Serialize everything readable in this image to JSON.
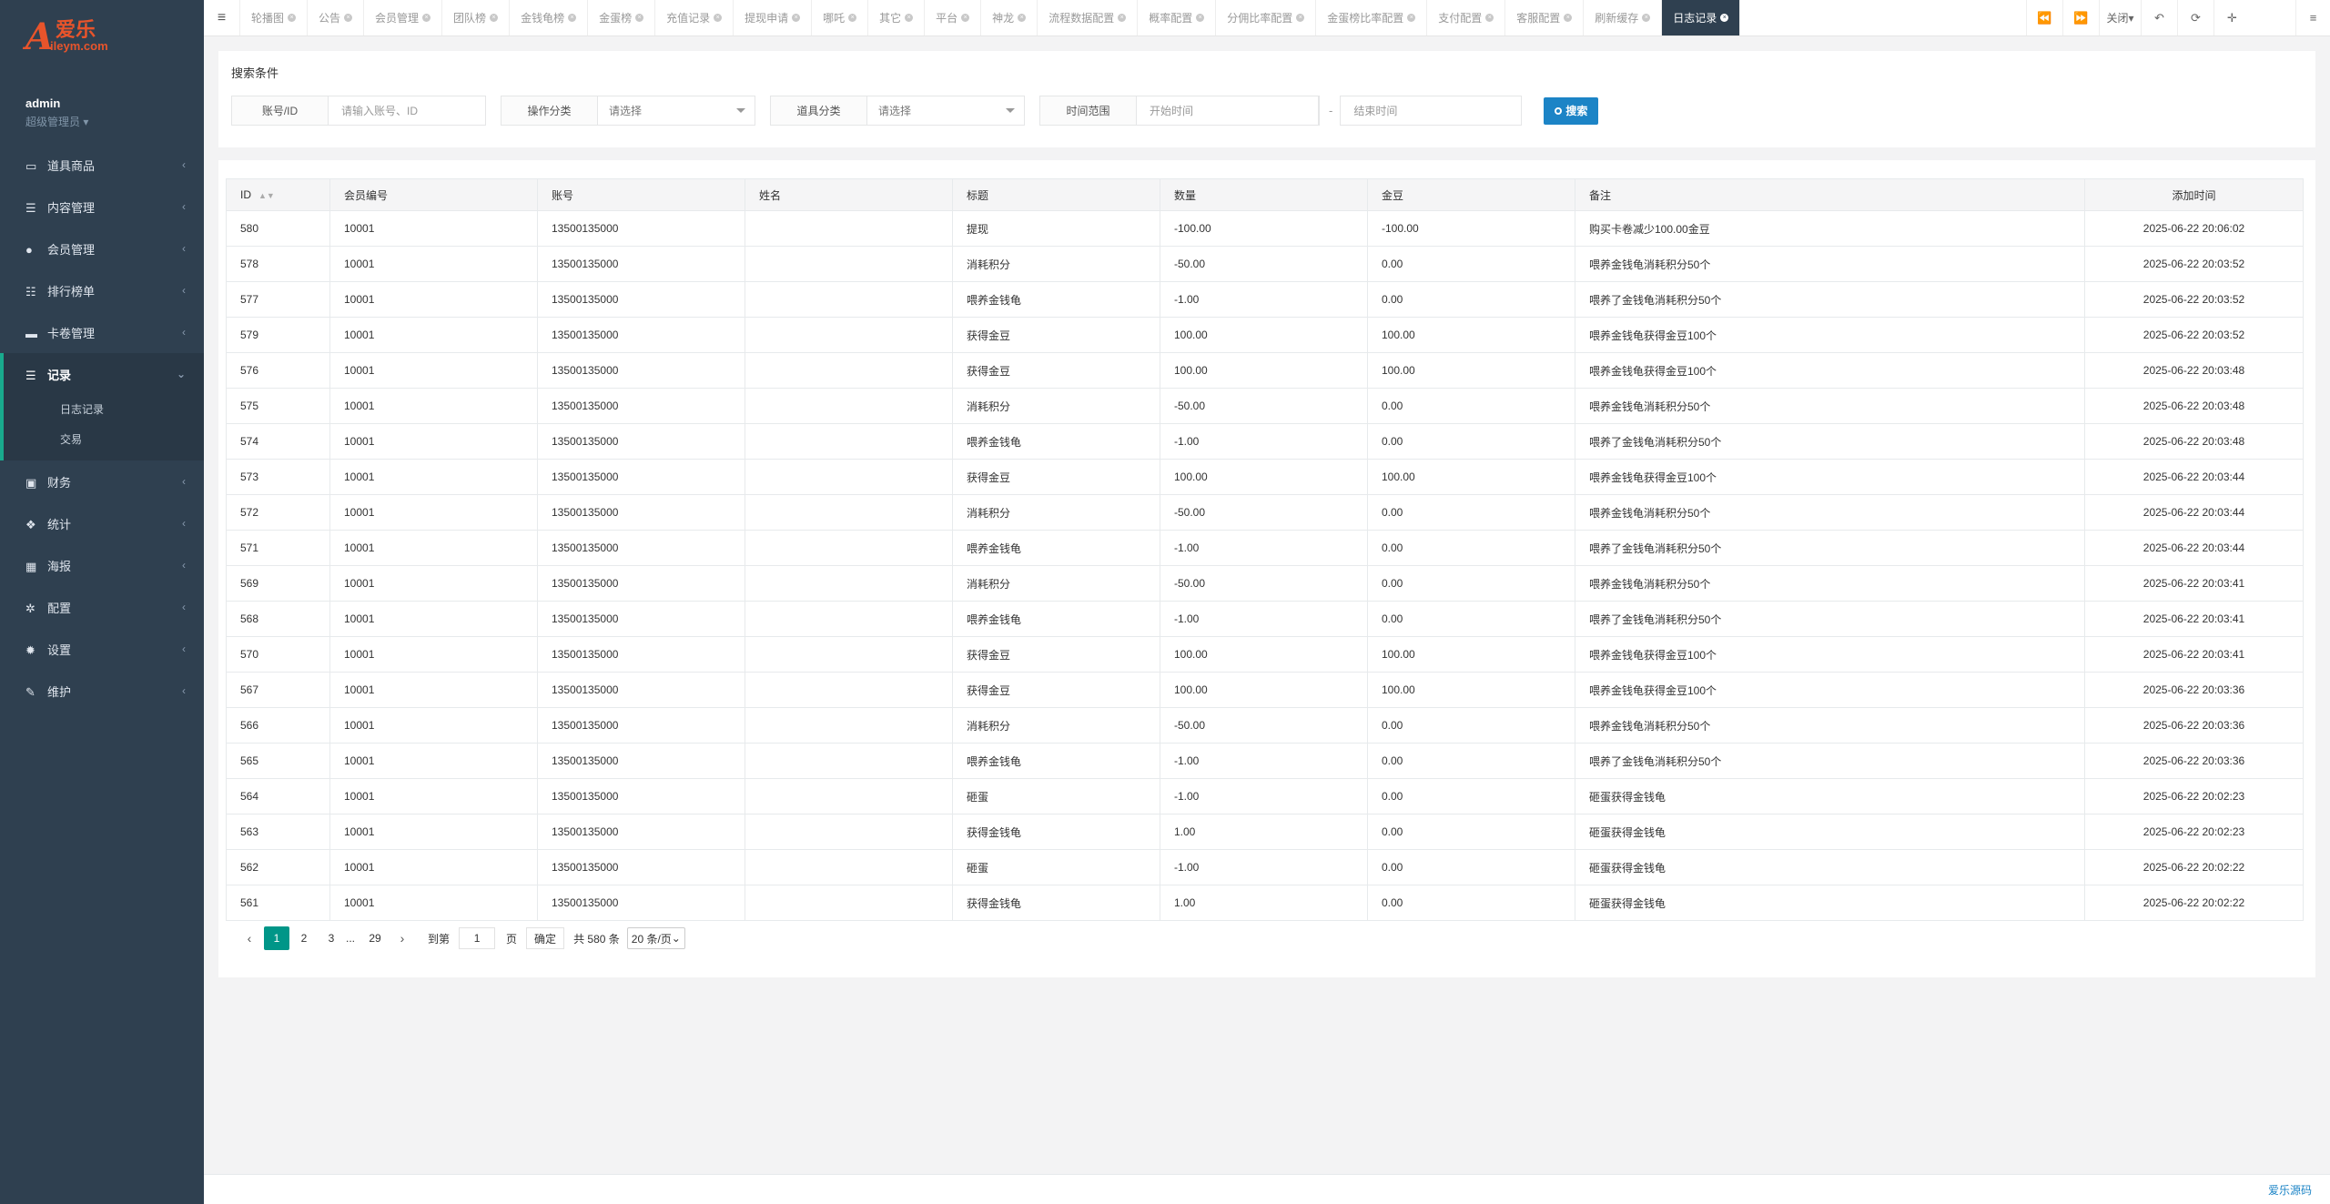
{
  "brand": {
    "logo_letter": "A",
    "logo_cn": "爱乐",
    "logo_en": "ileym.com"
  },
  "profile": {
    "name": "admin",
    "role": "超级管理员"
  },
  "sidebar": {
    "items": [
      {
        "label": "道具商品",
        "icon": "laptop-icon"
      },
      {
        "label": "内容管理",
        "icon": "database-icon"
      },
      {
        "label": "会员管理",
        "icon": "user-icon"
      },
      {
        "label": "排行榜单",
        "icon": "list-icon"
      },
      {
        "label": "卡卷管理",
        "icon": "card-icon"
      },
      {
        "label": "记录",
        "icon": "records-icon"
      },
      {
        "label": "财务",
        "icon": "money-icon"
      },
      {
        "label": "统计",
        "icon": "cubes-icon"
      },
      {
        "label": "海报",
        "icon": "image-icon"
      },
      {
        "label": "配置",
        "icon": "cogs-icon"
      },
      {
        "label": "设置",
        "icon": "gear-icon"
      },
      {
        "label": "维护",
        "icon": "wrench-icon"
      }
    ],
    "sub_items": [
      "日志记录",
      "交易"
    ]
  },
  "tabs": [
    "轮播图",
    "公告",
    "会员管理",
    "团队榜",
    "金钱龟榜",
    "金蛋榜",
    "充值记录",
    "提现申请",
    "哪吒",
    "其它",
    "平台",
    "神龙",
    "流程数据配置",
    "概率配置",
    "分佣比率配置",
    "金蛋榜比率配置",
    "支付配置",
    "客服配置",
    "刷新缓存",
    "日志记录"
  ],
  "toolbar": {
    "close_label": "关闭"
  },
  "search": {
    "title": "搜索条件",
    "account_label": "账号/ID",
    "account_placeholder": "请输入账号、ID",
    "op_label": "操作分类",
    "op_value": "请选择",
    "item_label": "道具分类",
    "item_value": "请选择",
    "time_label": "时间范围",
    "start_placeholder": "开始时间",
    "dash": "-",
    "end_placeholder": "结束时间",
    "button_label": "搜索"
  },
  "table": {
    "headers": [
      "ID",
      "会员编号",
      "账号",
      "姓名",
      "标题",
      "数量",
      "金豆",
      "备注",
      "添加时间"
    ],
    "rows": [
      [
        "580",
        "10001",
        "13500135000",
        "",
        "提现",
        "-100.00",
        "-100.00",
        "购买卡卷减少100.00金豆",
        "2025-06-22 20:06:02"
      ],
      [
        "578",
        "10001",
        "13500135000",
        "",
        "消耗积分",
        "-50.00",
        "0.00",
        "喂养金钱龟消耗积分50个",
        "2025-06-22 20:03:52"
      ],
      [
        "577",
        "10001",
        "13500135000",
        "",
        "喂养金钱龟",
        "-1.00",
        "0.00",
        "喂养了金钱龟消耗积分50个",
        "2025-06-22 20:03:52"
      ],
      [
        "579",
        "10001",
        "13500135000",
        "",
        "获得金豆",
        "100.00",
        "100.00",
        "喂养金钱龟获得金豆100个",
        "2025-06-22 20:03:52"
      ],
      [
        "576",
        "10001",
        "13500135000",
        "",
        "获得金豆",
        "100.00",
        "100.00",
        "喂养金钱龟获得金豆100个",
        "2025-06-22 20:03:48"
      ],
      [
        "575",
        "10001",
        "13500135000",
        "",
        "消耗积分",
        "-50.00",
        "0.00",
        "喂养金钱龟消耗积分50个",
        "2025-06-22 20:03:48"
      ],
      [
        "574",
        "10001",
        "13500135000",
        "",
        "喂养金钱龟",
        "-1.00",
        "0.00",
        "喂养了金钱龟消耗积分50个",
        "2025-06-22 20:03:48"
      ],
      [
        "573",
        "10001",
        "13500135000",
        "",
        "获得金豆",
        "100.00",
        "100.00",
        "喂养金钱龟获得金豆100个",
        "2025-06-22 20:03:44"
      ],
      [
        "572",
        "10001",
        "13500135000",
        "",
        "消耗积分",
        "-50.00",
        "0.00",
        "喂养金钱龟消耗积分50个",
        "2025-06-22 20:03:44"
      ],
      [
        "571",
        "10001",
        "13500135000",
        "",
        "喂养金钱龟",
        "-1.00",
        "0.00",
        "喂养了金钱龟消耗积分50个",
        "2025-06-22 20:03:44"
      ],
      [
        "569",
        "10001",
        "13500135000",
        "",
        "消耗积分",
        "-50.00",
        "0.00",
        "喂养金钱龟消耗积分50个",
        "2025-06-22 20:03:41"
      ],
      [
        "568",
        "10001",
        "13500135000",
        "",
        "喂养金钱龟",
        "-1.00",
        "0.00",
        "喂养了金钱龟消耗积分50个",
        "2025-06-22 20:03:41"
      ],
      [
        "570",
        "10001",
        "13500135000",
        "",
        "获得金豆",
        "100.00",
        "100.00",
        "喂养金钱龟获得金豆100个",
        "2025-06-22 20:03:41"
      ],
      [
        "567",
        "10001",
        "13500135000",
        "",
        "获得金豆",
        "100.00",
        "100.00",
        "喂养金钱龟获得金豆100个",
        "2025-06-22 20:03:36"
      ],
      [
        "566",
        "10001",
        "13500135000",
        "",
        "消耗积分",
        "-50.00",
        "0.00",
        "喂养金钱龟消耗积分50个",
        "2025-06-22 20:03:36"
      ],
      [
        "565",
        "10001",
        "13500135000",
        "",
        "喂养金钱龟",
        "-1.00",
        "0.00",
        "喂养了金钱龟消耗积分50个",
        "2025-06-22 20:03:36"
      ],
      [
        "564",
        "10001",
        "13500135000",
        "",
        "砸蛋",
        "-1.00",
        "0.00",
        "砸蛋获得金钱龟",
        "2025-06-22 20:02:23"
      ],
      [
        "563",
        "10001",
        "13500135000",
        "",
        "获得金钱龟",
        "1.00",
        "0.00",
        "砸蛋获得金钱龟",
        "2025-06-22 20:02:23"
      ],
      [
        "562",
        "10001",
        "13500135000",
        "",
        "砸蛋",
        "-1.00",
        "0.00",
        "砸蛋获得金钱龟",
        "2025-06-22 20:02:22"
      ],
      [
        "561",
        "10001",
        "13500135000",
        "",
        "获得金钱龟",
        "1.00",
        "0.00",
        "砸蛋获得金钱龟",
        "2025-06-22 20:02:22"
      ]
    ]
  },
  "pagination": {
    "pages": [
      "1",
      "2",
      "3"
    ],
    "ellipsis": "...",
    "last_page": "29",
    "goto_label": "到第",
    "current_input": "1",
    "page_unit": "页",
    "ok_label": "确定",
    "total_text": "共 580 条",
    "page_size": "20 条/页"
  },
  "footer": {
    "credit": "爱乐源码"
  },
  "colors": {
    "sidebar": "#2f4050",
    "accent": "#19aa8d",
    "primary": "#1c84c6",
    "page_active": "#009688",
    "logo": "#e8542b"
  }
}
